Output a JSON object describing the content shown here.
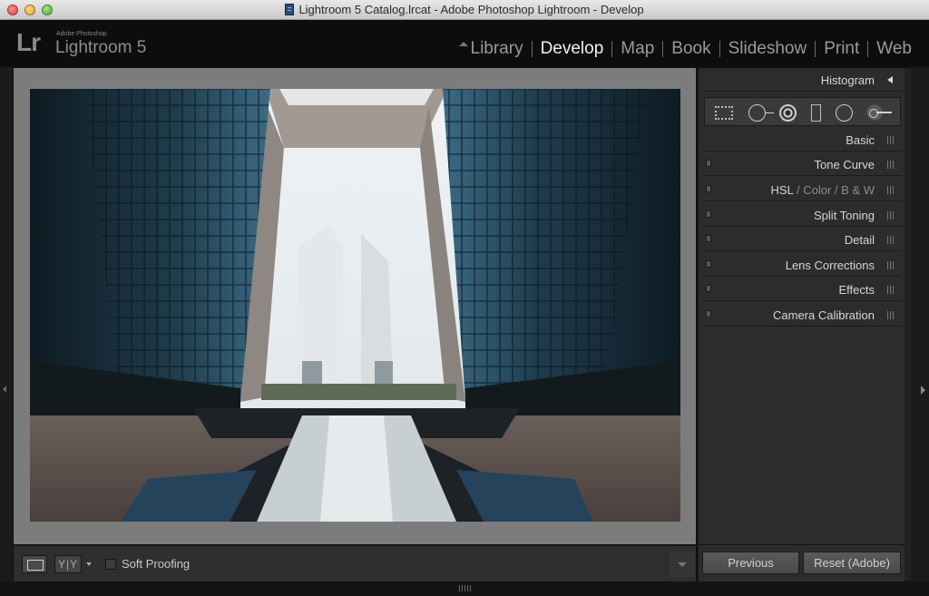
{
  "window": {
    "title": "Lightroom 5 Catalog.lrcat - Adobe Photoshop Lightroom - Develop"
  },
  "identity": {
    "logo": "Lr",
    "subtitle": "Adobe Photoshop",
    "name": "Lightroom 5"
  },
  "modules": [
    {
      "label": "Library",
      "active": false
    },
    {
      "label": "Develop",
      "active": true
    },
    {
      "label": "Map",
      "active": false
    },
    {
      "label": "Book",
      "active": false
    },
    {
      "label": "Slideshow",
      "active": false
    },
    {
      "label": "Print",
      "active": false
    },
    {
      "label": "Web",
      "active": false
    }
  ],
  "right_panel": {
    "histogram_label": "Histogram",
    "tools": [
      "crop-overlay-icon",
      "spot-removal-icon",
      "red-eye-icon",
      "graduated-filter-icon",
      "radial-filter-icon",
      "adjustment-brush-icon"
    ],
    "panels": {
      "basic": "Basic",
      "tone_curve": "Tone Curve",
      "hsl": "HSL",
      "hsl_sep1": "/",
      "color": "Color",
      "hsl_sep2": "/",
      "bw": "B & W",
      "split_toning": "Split Toning",
      "detail": "Detail",
      "lens_corrections": "Lens Corrections",
      "effects": "Effects",
      "camera_calibration": "Camera Calibration"
    },
    "previous_label": "Previous",
    "reset_label": "Reset (Adobe)"
  },
  "toolbar": {
    "yy_label": "Y|Y",
    "soft_proofing_label": "Soft Proofing",
    "soft_proofing_checked": false
  },
  "colors": {
    "accent_active_module": "#f0f0f0",
    "inactive_module": "#9a9a9a",
    "panel_bg": "#2c2c2c",
    "main_bg": "#7c7c7c"
  }
}
